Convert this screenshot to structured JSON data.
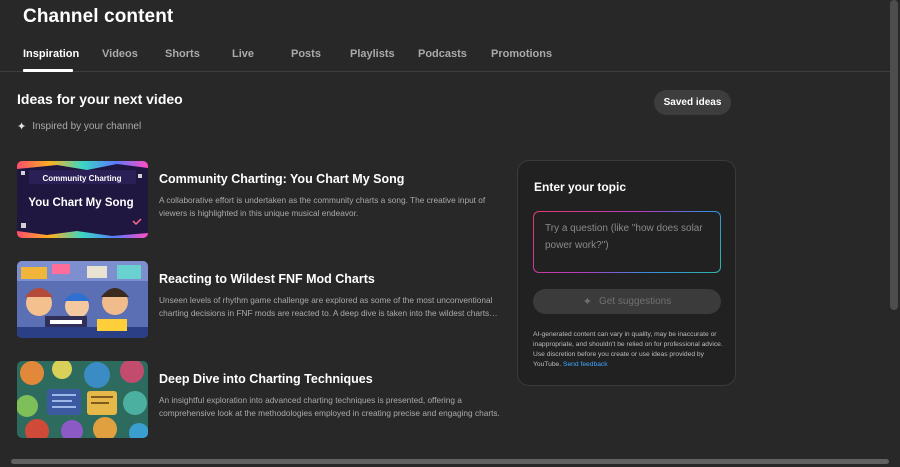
{
  "page": {
    "title": "Channel content"
  },
  "tabs": [
    {
      "label": "Inspiration",
      "active": true
    },
    {
      "label": "Videos"
    },
    {
      "label": "Shorts"
    },
    {
      "label": "Live"
    },
    {
      "label": "Posts"
    },
    {
      "label": "Playlists"
    },
    {
      "label": "Podcasts"
    },
    {
      "label": "Promotions"
    }
  ],
  "inspiration": {
    "heading": "Ideas for your next video",
    "subheading": "Inspired by your channel",
    "saved_ideas_label": "Saved ideas",
    "ideas": [
      {
        "title": "Community Charting: You Chart My Song",
        "description": "A collaborative effort is undertaken as the community charts a song. The creative input of viewers is highlighted in this unique musical endeavor.",
        "thumb_line1": "Community Charting",
        "thumb_line2": "You Chart My Song"
      },
      {
        "title": "Reacting to Wildest FNF Mod Charts",
        "description": "Unseen levels of rhythm game challenge are explored as some of the most unconventional charting decisions in FNF mods are reacted to. A deep dive is taken into the wildest charts ever made."
      },
      {
        "title": "Deep Dive into Charting Techniques",
        "description": "An insightful exploration into advanced charting techniques is presented, offering a comprehensive look at the methodologies employed in creating precise and engaging charts."
      }
    ]
  },
  "topic_panel": {
    "title": "Enter your topic",
    "input_value": "",
    "input_placeholder": "Try a question (like \"how does solar power work?\")",
    "button_label": "Get suggestions",
    "disclaimer": "AI-generated content can vary in quality, may be inaccurate or inappropriate, and shouldn't be relied on for professional advice. Use discretion before you create or use ideas provided by YouTube.",
    "feedback_link": "Send feedback"
  },
  "colors": {
    "background": "#282828",
    "panel": "#212121",
    "link": "#3ea6ff"
  },
  "icons": {
    "subheading_icon": "sparkle-icon",
    "button_icon": "sparkle-icon"
  }
}
